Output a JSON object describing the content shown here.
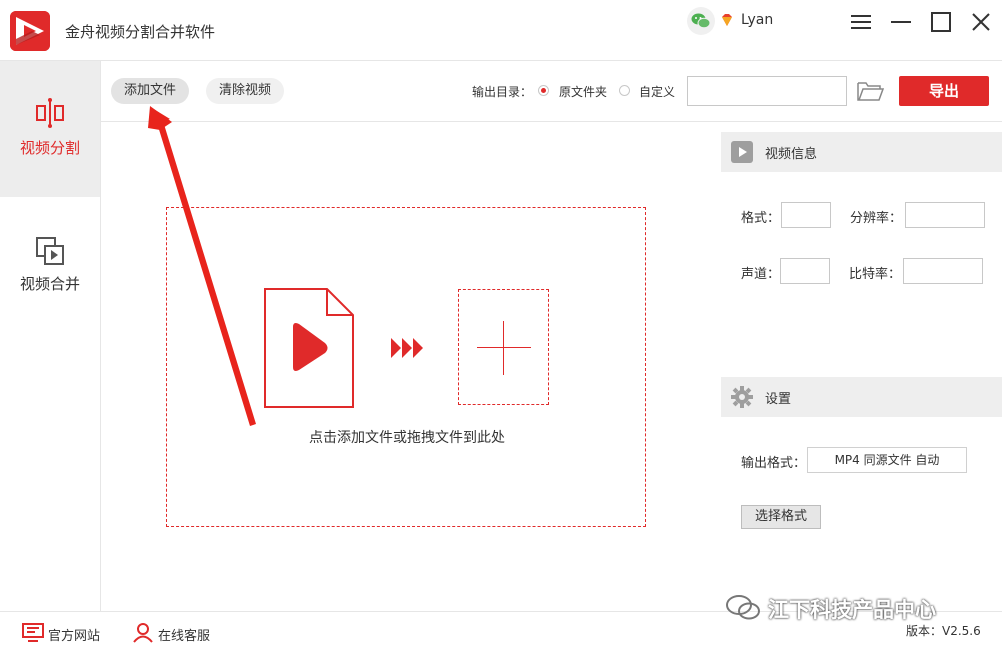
{
  "app": {
    "title": "金舟视频分割合并软件",
    "username": "Lyan",
    "logo_icon": "video-play-logo",
    "accent_color": "#e02a2a"
  },
  "nav": {
    "items": [
      {
        "label": "视频分割",
        "icon": "split-icon",
        "active": true
      },
      {
        "label": "视频合并",
        "icon": "merge-icon",
        "active": false
      }
    ]
  },
  "toolbar": {
    "add_file_label": "添加文件",
    "clear_video_label": "清除视频",
    "output_dir_label": "输出目录：",
    "radio_source_label": "原文件夹",
    "radio_custom_label": "自定义",
    "output_path_value": "",
    "export_label": "导出"
  },
  "dropzone": {
    "hint": "点击添加文件或拖拽文件到此处"
  },
  "video_info": {
    "header": "视频信息",
    "format_label": "格式：",
    "resolution_label": "分辨率：",
    "channels_label": "声道：",
    "bitrate_label": "比特率："
  },
  "settings": {
    "header": "设置",
    "output_format_label": "输出格式：",
    "output_format_value": "MP4 同源文件 自动",
    "choose_format_label": "选择格式"
  },
  "footer": {
    "website_label": "官方网站",
    "support_label": "在线客服",
    "version": "版本：V2.5.6",
    "watermark": "江下科技产品中心"
  }
}
